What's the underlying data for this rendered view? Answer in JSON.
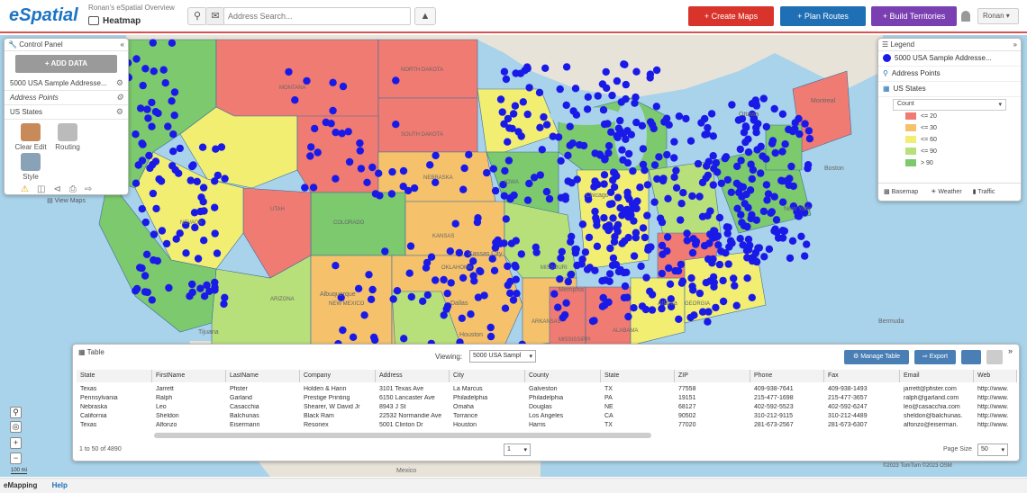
{
  "header": {
    "logo": "eSpatial",
    "breadcrumb": "Ronan's eSpatial Overview",
    "view_title": "Heatmap",
    "search_placeholder": "Address Search...",
    "buttons": [
      {
        "label": "+ Create Maps",
        "color": "#d9342b"
      },
      {
        "label": "+ Plan Routes",
        "color": "#1f6fb5"
      },
      {
        "label": "+ Build Territories",
        "color": "#7a3fb0"
      }
    ],
    "user": "Ronan"
  },
  "control_panel": {
    "title": "Control Panel",
    "add_data": "ADD DATA",
    "layers": [
      "5000 USA Sample Addresse...",
      "Address Points",
      "US States"
    ],
    "tools": [
      "Clear Edit",
      "Routing",
      "Style"
    ],
    "view_maps": "View Maps"
  },
  "legend": {
    "title": "Legend",
    "layers": [
      "5000 USA Sample Addresse...",
      "Address Points",
      "US States"
    ],
    "count_label": "Count",
    "ranges": [
      {
        "label": "<= 20",
        "color": "#f07b72"
      },
      {
        "label": "<= 30",
        "color": "#f5c26b"
      },
      {
        "label": "<= 60",
        "color": "#f2ee72"
      },
      {
        "label": "<= 90",
        "color": "#b8e07a"
      },
      {
        "label": "> 90",
        "color": "#7cc96e"
      }
    ],
    "footer": [
      "Basemap",
      "Weather",
      "Traffic"
    ]
  },
  "map_labels": {
    "states": [
      "MONTANA",
      "NORTH DAKOTA",
      "SOUTH DAKOTA",
      "NEBRASKA",
      "KANSAS",
      "COLORADO",
      "NEW MEXICO",
      "ARIZONA",
      "NEVADA",
      "UTAH",
      "IOWA",
      "MISSOURI",
      "ARKANSAS",
      "OKLAHOMA",
      "MISSISSIPPI",
      "ALABAMA",
      "GEORGIA"
    ],
    "cities": [
      "Ottawa",
      "Montreal",
      "Boston",
      "New York",
      "Chicago",
      "Kansas City",
      "Dallas",
      "Houston",
      "Memphis",
      "Atlanta",
      "Albuquerque",
      "Tijuana",
      "Bermuda",
      "Mexico"
    ]
  },
  "table": {
    "title": "Table",
    "viewing_label": "Viewing:",
    "viewing_value": "5000 USA Sampl",
    "manage_table": "Manage Table",
    "export": "Export",
    "columns": [
      "State",
      "FirstName",
      "LastName",
      "Company",
      "Address",
      "City",
      "County",
      "State",
      "ZIP",
      "Phone",
      "Fax",
      "Email",
      "Web"
    ],
    "rows": [
      [
        "Texas",
        "Jarrett",
        "Pfister",
        "Holden & Hann",
        "3101 Texas Ave",
        "La Marcus",
        "Galveston",
        "TX",
        "77558",
        "409-938-7641",
        "409-938-1493",
        "jarrett@pfister.com",
        "http://www."
      ],
      [
        "Pennsylvania",
        "Ralph",
        "Garland",
        "Prestige Printing",
        "6150 Lancaster Ave",
        "Philadelphia",
        "Philadelphia",
        "PA",
        "19151",
        "215-477-1698",
        "215-477-3657",
        "ralph@garland.com",
        "http://www."
      ],
      [
        "Nebraska",
        "Leo",
        "Casacchia",
        "Shearer, W David Jr",
        "8943 J St",
        "Omaha",
        "Douglas",
        "NE",
        "68127",
        "402-592-5523",
        "402-592-6247",
        "leo@casacchia.com",
        "http://www."
      ],
      [
        "California",
        "Sheldon",
        "Balchunas",
        "Black Ram",
        "22532 Normandie Ave",
        "Torrance",
        "Los Angeles",
        "CA",
        "90502",
        "310-212-9115",
        "310-212-4489",
        "sheldon@balchunas.",
        "http://www."
      ],
      [
        "Texas",
        "Alfonzo",
        "Eisermann",
        "Resonex",
        "5001 Clinton Dr",
        "Houston",
        "Harris",
        "TX",
        "77020",
        "281-673-2567",
        "281-673-6307",
        "alfonzo@eiserman.",
        "http://www."
      ]
    ],
    "record_count": "1 to 50 of 4890",
    "page": "1",
    "page_size_label": "Page Size",
    "page_size": "50"
  },
  "map_footer": {
    "scale": "100 mi",
    "attribution": "©2023 TomTom ©2023 OSM"
  },
  "footer": {
    "brand": "eMapping",
    "help": "Help"
  }
}
